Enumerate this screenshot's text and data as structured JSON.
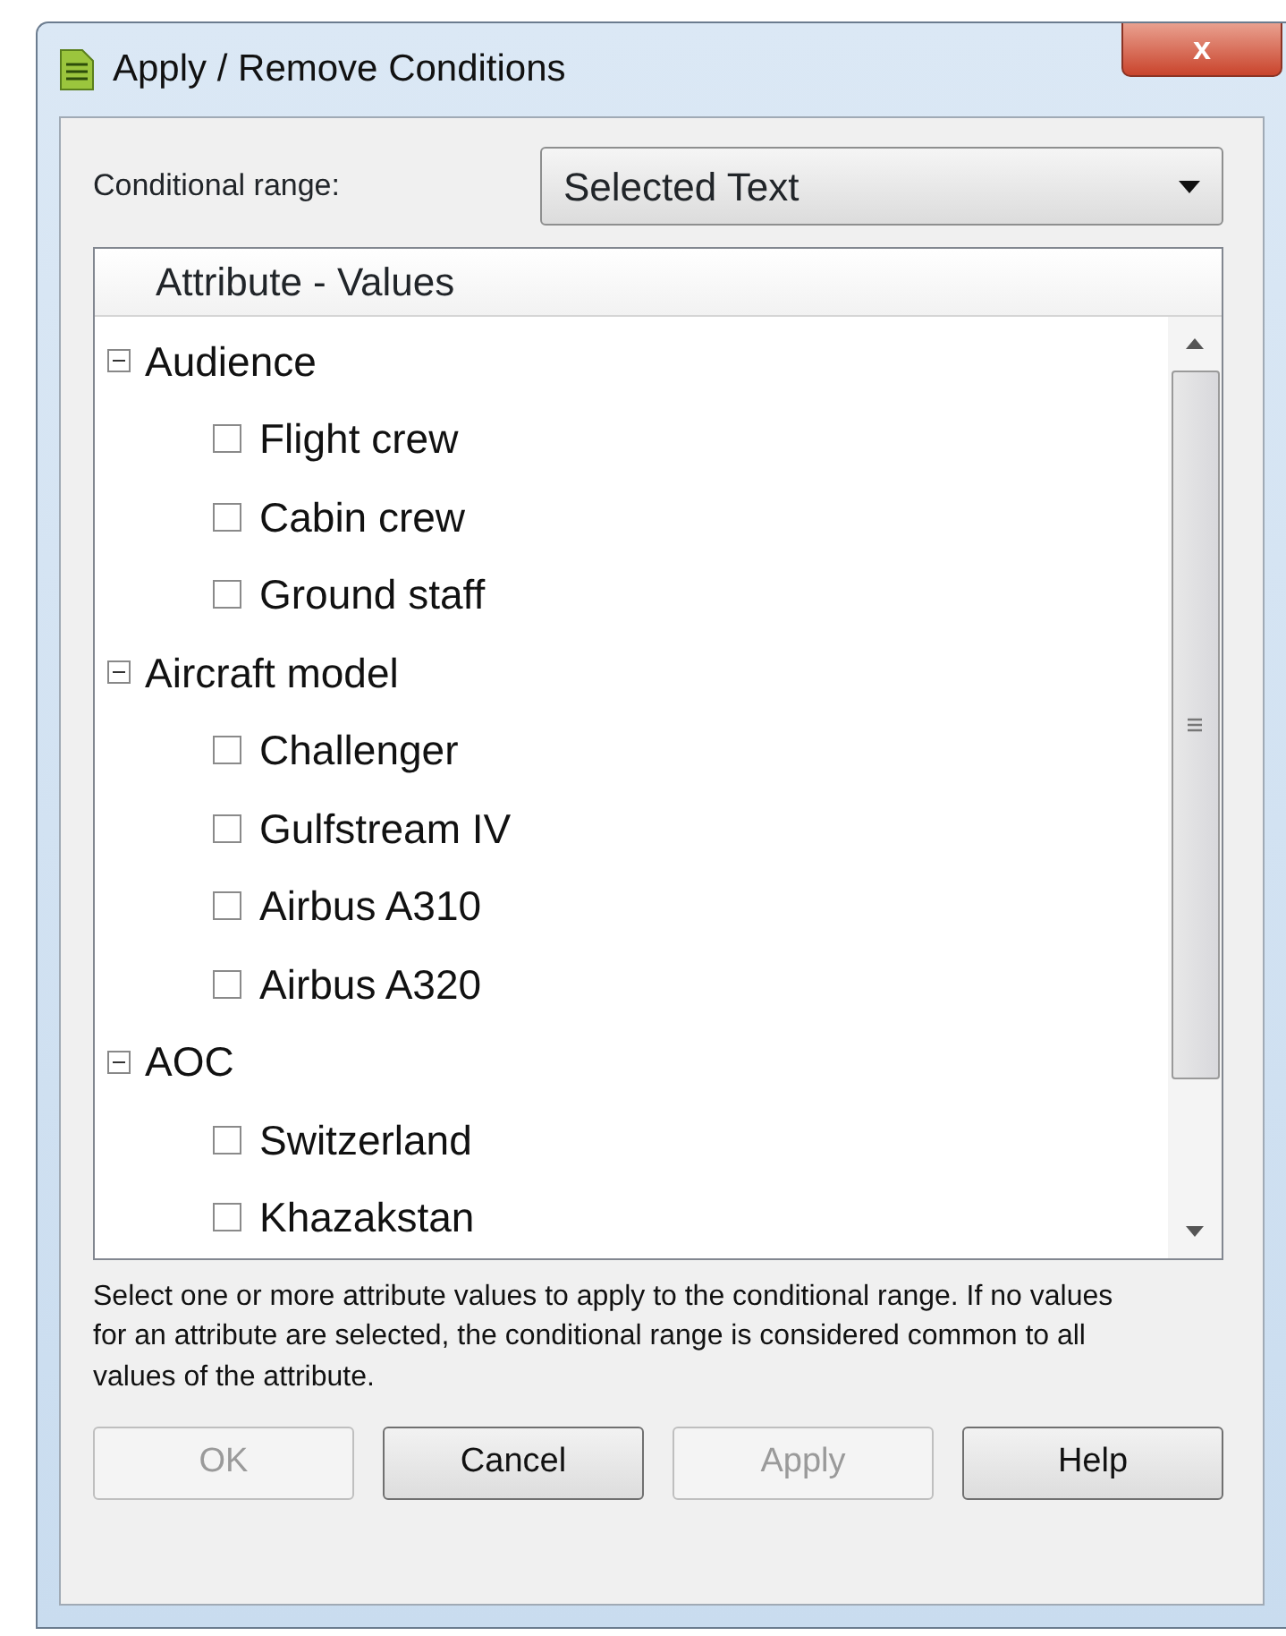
{
  "window": {
    "title": "Apply / Remove Conditions",
    "close": "x"
  },
  "conditional_range": {
    "label": "Conditional range:",
    "value": "Selected Text"
  },
  "tree": {
    "header": "Attribute - Values",
    "groups": [
      {
        "label": "Audience",
        "expanded": true,
        "children": [
          {
            "label": "Flight crew",
            "checked": false
          },
          {
            "label": "Cabin crew",
            "checked": false
          },
          {
            "label": "Ground staff",
            "checked": false
          }
        ]
      },
      {
        "label": "Aircraft model",
        "expanded": true,
        "children": [
          {
            "label": "Challenger",
            "checked": false
          },
          {
            "label": "Gulfstream IV",
            "checked": false
          },
          {
            "label": "Airbus A310",
            "checked": false
          },
          {
            "label": "Airbus A320",
            "checked": false
          }
        ]
      },
      {
        "label": "AOC",
        "expanded": true,
        "children": [
          {
            "label": "Switzerland",
            "checked": false
          },
          {
            "label": "Khazakstan",
            "checked": false
          }
        ]
      }
    ]
  },
  "hint": "Select one or more attribute values to apply to the conditional range. If no values for an attribute are selected, the conditional range is considered common to all values of the attribute.",
  "buttons": [
    {
      "label": "OK",
      "disabled": true
    },
    {
      "label": "Cancel",
      "disabled": false
    },
    {
      "label": "Apply",
      "disabled": true
    },
    {
      "label": "Help",
      "disabled": false
    }
  ]
}
